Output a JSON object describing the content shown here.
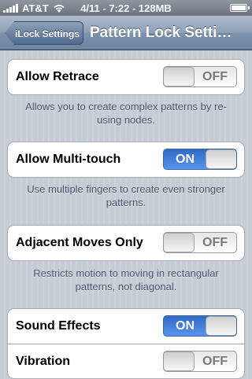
{
  "status_bar": {
    "carrier": "AT&T",
    "center": "4/11 - 7:22 - 128MB"
  },
  "nav": {
    "back_label": "iLock Settings",
    "title": "Pattern Lock Setti…"
  },
  "colors": {
    "toggle_on": "#3f7be0",
    "background": "#c5ccd4",
    "footer_text": "#4c566c"
  },
  "settings": [
    {
      "label": "Allow Retrace",
      "state": "OFF",
      "footer": "Allows you to create complex patterns by re-using nodes."
    },
    {
      "label": "Allow Multi-touch",
      "state": "ON",
      "footer": "Use multiple fingers to create even stronger patterns."
    },
    {
      "label": "Adjacent Moves Only",
      "state": "OFF",
      "footer": "Restricts motion to moving in rectangular patterns, not diagonal."
    },
    {
      "label": "Sound Effects",
      "state": "ON"
    },
    {
      "label": "Vibration",
      "state": "OFF"
    }
  ]
}
